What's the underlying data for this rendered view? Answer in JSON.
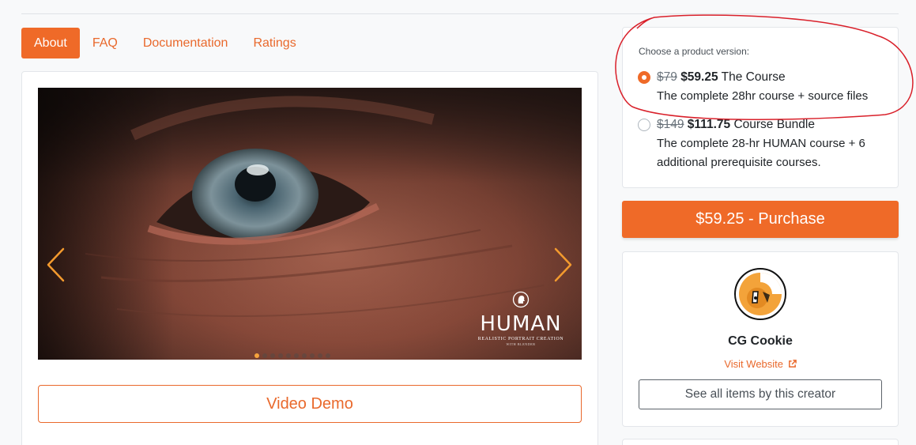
{
  "tabs": [
    {
      "label": "About",
      "active": true
    },
    {
      "label": "FAQ",
      "active": false
    },
    {
      "label": "Documentation",
      "active": false
    },
    {
      "label": "Ratings",
      "active": false
    }
  ],
  "carousel": {
    "logo_word": "HUMAN",
    "logo_subtitle": "REALISTIC PORTRAIT CREATION",
    "logo_subtitle2": "WITH BLENDER",
    "active_slide": 1,
    "slide_count": 10
  },
  "video_demo_label": "Video Demo",
  "version": {
    "label": "Choose a product version:",
    "options": [
      {
        "old_price": "$79",
        "price": "$59.25",
        "name": "The Course",
        "description": "The complete 28hr course + source files",
        "selected": true
      },
      {
        "old_price": "$149",
        "price": "$111.75",
        "name": "Course Bundle",
        "description_line1": "The complete 28-hr HUMAN course + 6",
        "description_line2": "additional prerequisite courses.",
        "selected": false
      }
    ]
  },
  "purchase_label": "$59.25 - Purchase",
  "creator": {
    "name": "CG Cookie",
    "visit_label": "Visit Website",
    "see_all_label": "See all items by this creator"
  },
  "colors": {
    "accent": "#ef6a28",
    "annotation": "#d9202a"
  },
  "icons": {
    "prev": "chevron-left-icon",
    "next": "chevron-right-icon",
    "external": "external-link-icon"
  }
}
